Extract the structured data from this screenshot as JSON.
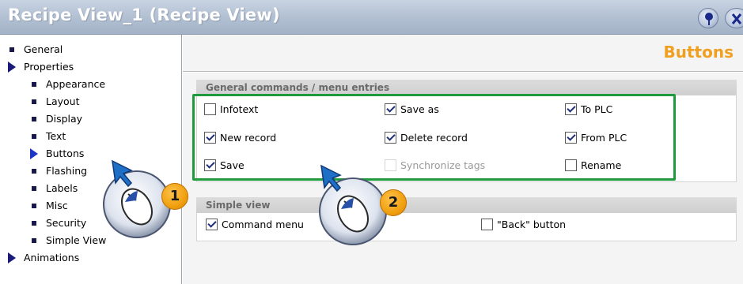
{
  "window": {
    "title": "Recipe View_1 (Recipe View)",
    "help_icon": "help-pin-icon",
    "close_icon": "close-icon"
  },
  "tree": {
    "items": [
      {
        "label": "General",
        "icon": "bullet"
      },
      {
        "label": "Properties",
        "icon": "expand-triangle"
      },
      {
        "label": "Appearance",
        "icon": "bullet"
      },
      {
        "label": "Layout",
        "icon": "bullet"
      },
      {
        "label": "Display",
        "icon": "bullet"
      },
      {
        "label": "Text",
        "icon": "bullet"
      },
      {
        "label": "Buttons",
        "icon": "selected-triangle"
      },
      {
        "label": "Flashing",
        "icon": "bullet"
      },
      {
        "label": "Labels",
        "icon": "bullet"
      },
      {
        "label": "Misc",
        "icon": "bullet"
      },
      {
        "label": "Security",
        "icon": "bullet"
      },
      {
        "label": "Simple View",
        "icon": "bullet"
      },
      {
        "label": "Animations",
        "icon": "expand-triangle"
      }
    ],
    "selected": "Buttons"
  },
  "page": {
    "title": "Buttons"
  },
  "general_commands": {
    "header": "General commands / menu entries",
    "options": [
      {
        "label": "Infotext",
        "checked": false,
        "enabled": true
      },
      {
        "label": "Save as",
        "checked": true,
        "enabled": true
      },
      {
        "label": "To PLC",
        "checked": true,
        "enabled": true
      },
      {
        "label": "New record",
        "checked": true,
        "enabled": true
      },
      {
        "label": "Delete record",
        "checked": true,
        "enabled": true
      },
      {
        "label": "From PLC",
        "checked": true,
        "enabled": true
      },
      {
        "label": "Save",
        "checked": true,
        "enabled": true
      },
      {
        "label": "Synchronize tags",
        "checked": false,
        "enabled": false
      },
      {
        "label": "Rename",
        "checked": false,
        "enabled": true
      }
    ]
  },
  "simple_view": {
    "header": "Simple view",
    "options": [
      {
        "label": "Command menu",
        "checked": true,
        "enabled": true
      },
      {
        "label": "\"Back\" button",
        "checked": false,
        "enabled": true
      }
    ]
  },
  "callouts": [
    {
      "number": "1",
      "icon": "mouse-click-icon"
    },
    {
      "number": "2",
      "icon": "mouse-click-icon"
    }
  ],
  "colors": {
    "page_title": "#f0a020",
    "highlight_frame": "#1f9a3c",
    "callout_badge": "#f0a010",
    "titlebar": "#b4c2d4"
  }
}
